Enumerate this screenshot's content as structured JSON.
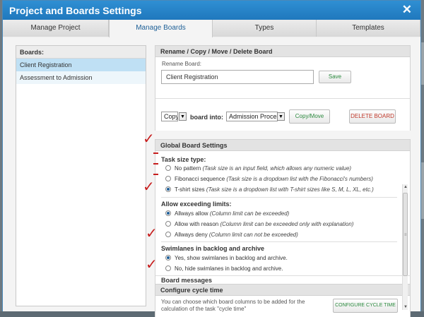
{
  "dialog": {
    "title": "Project and Boards Settings",
    "close_glyph": "✕"
  },
  "tabs": [
    {
      "label": "Manage Project"
    },
    {
      "label": "Manage Boards"
    },
    {
      "label": "Types"
    },
    {
      "label": "Templates"
    }
  ],
  "boards": {
    "header": "Boards:",
    "items": [
      "Client Registration",
      "Assessment to Admission"
    ]
  },
  "rename": {
    "header": "Rename / Copy / Move / Delete Board",
    "label": "Rename Board:",
    "value": "Client Registration",
    "save": "Save"
  },
  "copy": {
    "action": "Copy",
    "middle_text": "board into:",
    "target": "Admission Proces:",
    "copymove": "Copy/Move",
    "delete": "DELETE BOARD"
  },
  "global": {
    "header": "Global Board Settings",
    "task_size": {
      "label": "Task size type:",
      "options": [
        {
          "name": "No pattern",
          "desc": "(Task size is an input field, which allows any numeric value)",
          "selected": false
        },
        {
          "name": "Fibonacci sequence",
          "desc": "(Task size is a dropdown list with the Fibonacci's numbers)",
          "selected": false
        },
        {
          "name": "T-shirt sizes",
          "desc": "(Task size is a dropdown list with T-shirt sizes like S, M, L, XL, etc.)",
          "selected": true
        }
      ]
    },
    "exceeding": {
      "label": "Allow exceeding limits:",
      "options": [
        {
          "name": "Allways allow",
          "desc": "(Column limit can be exceeded)",
          "selected": true
        },
        {
          "name": "Allow with reason",
          "desc": "(Column limit can be exceeded only with explanation)",
          "selected": false
        },
        {
          "name": "Allways deny",
          "desc": "(Column limit can not be exceeded)",
          "selected": false
        }
      ]
    },
    "swimlanes": {
      "label": "Swimlanes in backlog and archive",
      "options": [
        {
          "name": "Yes, show swimlanes in backlog and archive.",
          "selected": true
        },
        {
          "name": "No, hide swimlanes in backlog and archive.",
          "selected": false
        }
      ]
    },
    "board_messages": "Board messages"
  },
  "cycle": {
    "header": "Configure cycle time",
    "text_line1": "You can choose which board columns to be added for the",
    "text_line2": "calculation of the task \"cycle time\"",
    "button": "CONFIGURE CYCLE TIME"
  },
  "colors": {
    "titlebar": "#1f78bd",
    "annotation": "#c71d1d",
    "selected_board": "#bfe0f4"
  }
}
